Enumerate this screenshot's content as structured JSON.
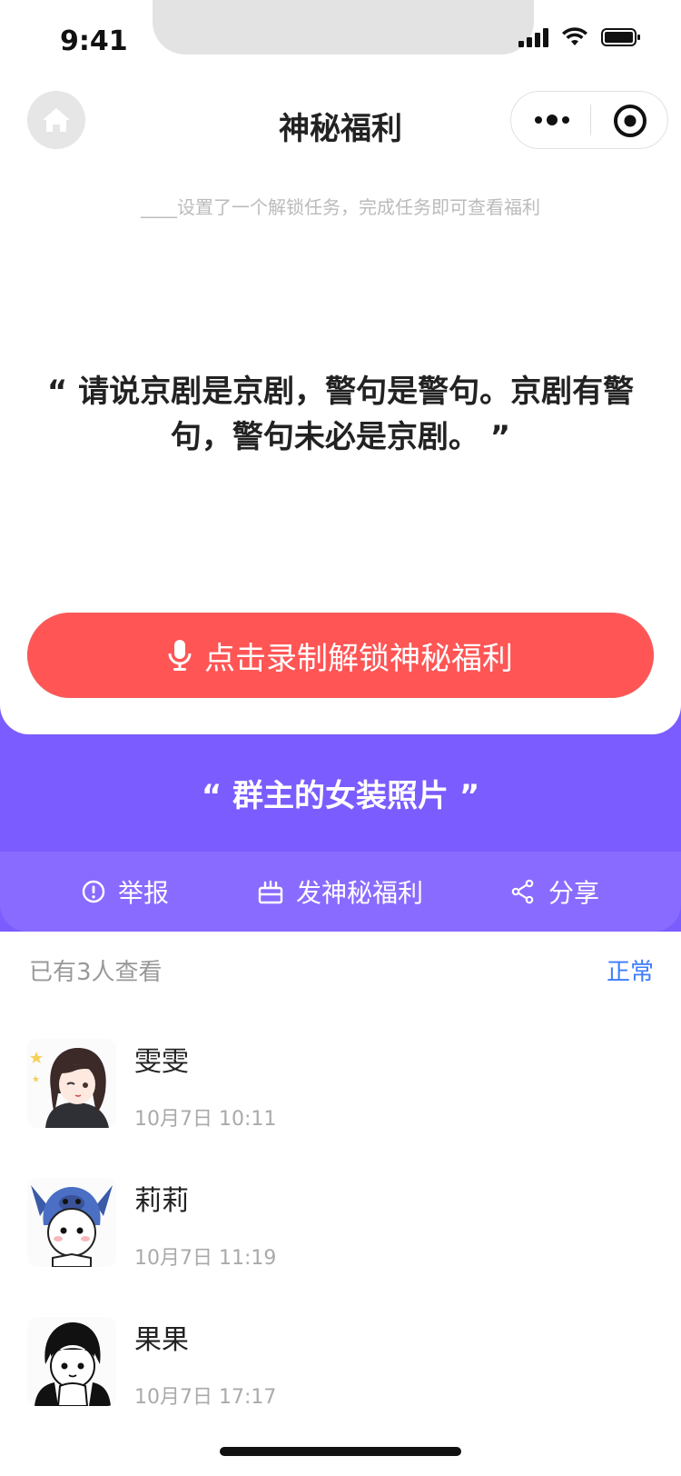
{
  "status_bar": {
    "time": "9:41"
  },
  "nav": {
    "title": "神秘福利"
  },
  "subtitle": "____设置了一个解锁任务，完成任务即可查看福利",
  "task_quote": "“ 请说京剧是京剧，警句是警句。京剧有警句，警句未必是京剧。 ”",
  "record_button_label": "点击录制解锁神秘福利",
  "reward_title": "“ 群主的女装照片 ”",
  "actions": {
    "report": "举报",
    "send": "发神秘福利",
    "share": "分享"
  },
  "viewers": {
    "count_text": "已有3人查看",
    "status": "正常",
    "items": [
      {
        "name": "雯雯",
        "time": "10月7日 10:11"
      },
      {
        "name": "莉莉",
        "time": "10月7日 11:19"
      },
      {
        "name": "果果",
        "time": "10月7日 17:17"
      }
    ]
  },
  "colors": {
    "record_red": "#ff5555",
    "purple": "#7b5cff",
    "link_blue": "#3d7cff"
  }
}
